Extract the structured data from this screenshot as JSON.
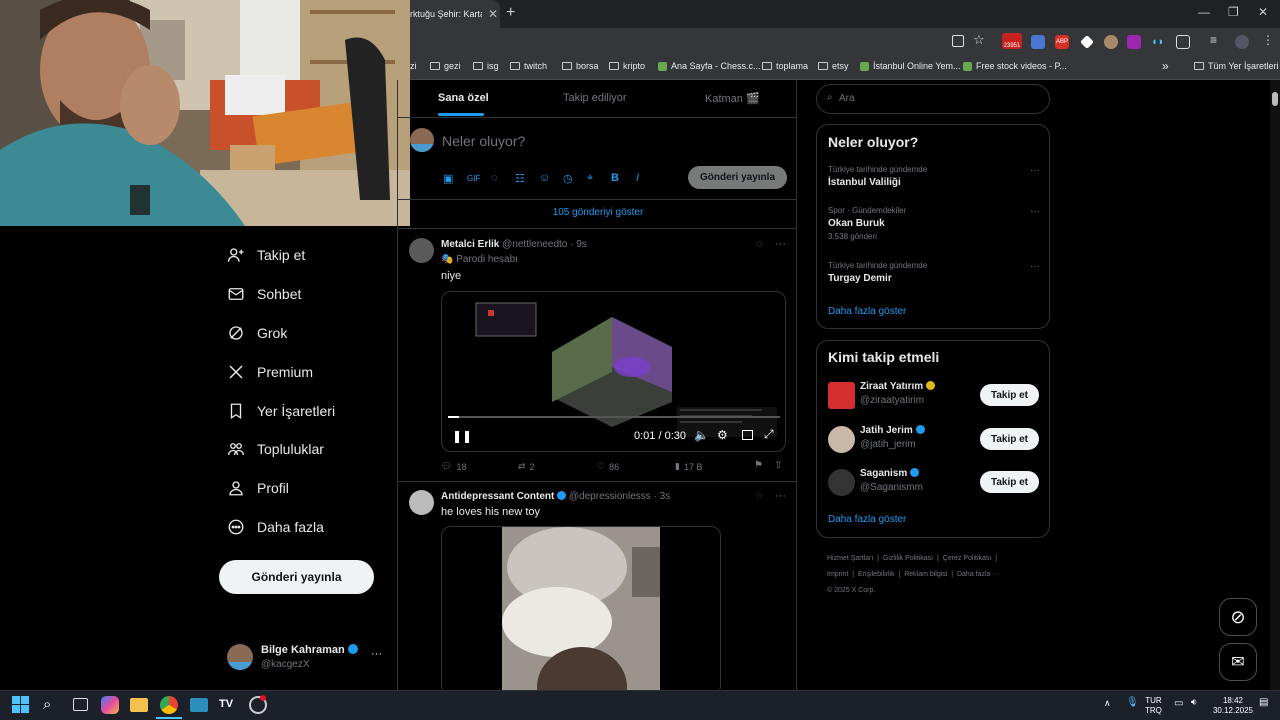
{
  "browser": {
    "tab_title": "rktuğu Şehir: Karta",
    "tab_close": "✕",
    "new_tab": "+",
    "extension_badge": "23951",
    "bookmarks": [
      {
        "label": "izi",
        "type": "text"
      },
      {
        "label": "gezi",
        "type": "folder"
      },
      {
        "label": "isg",
        "type": "folder"
      },
      {
        "label": "twitch",
        "type": "folder"
      },
      {
        "label": "borsa",
        "type": "folder"
      },
      {
        "label": "kripto",
        "type": "folder"
      },
      {
        "label": "Ana Sayfa - Chess.c...",
        "type": "site"
      },
      {
        "label": "toplama",
        "type": "folder"
      },
      {
        "label": "etsy",
        "type": "folder"
      },
      {
        "label": "İstanbul Online Yem...",
        "type": "site"
      },
      {
        "label": "Free stock videos - P...",
        "type": "site"
      },
      {
        "label": "Tüm Yer İşaretleri",
        "type": "folder"
      }
    ],
    "more_bookmarks": "»"
  },
  "nav": {
    "items": [
      {
        "label": "Takip et",
        "icon": "add-user-icon"
      },
      {
        "label": "Sohbet",
        "icon": "mail-icon"
      },
      {
        "label": "Grok",
        "icon": "grok-icon"
      },
      {
        "label": "Premium",
        "icon": "x-logo-icon"
      },
      {
        "label": "Yer İşaretleri",
        "icon": "bookmark-icon"
      },
      {
        "label": "Topluluklar",
        "icon": "communities-icon"
      },
      {
        "label": "Profil",
        "icon": "profile-icon"
      },
      {
        "label": "Daha fazla",
        "icon": "more-circle-icon"
      }
    ],
    "post_button": "Gönderi yayınla",
    "account": {
      "name": "Bilge Kahraman",
      "handle": "@kacgezX",
      "more": "···"
    }
  },
  "feed": {
    "tabs": [
      "Sana özel",
      "Takip ediliyor",
      "Katman 🎬"
    ],
    "compose_placeholder": "Neler oluyor?",
    "compose_button": "Gönderi yayınla",
    "show_more_posts": "105 gönderiyi göster",
    "posts": [
      {
        "name": "Metalci Erlik",
        "handle": "@nettleneedto · 9s",
        "badge": "Parodi hesabı",
        "text": "niye",
        "video_time": "0:01 / 0:30",
        "video_progress": 0.033,
        "replies": "18",
        "reposts": "2",
        "likes": "86",
        "views": "17 B"
      },
      {
        "name": "Antidepressant Content",
        "handle": "@depressionlesss · 3s",
        "text": "he loves his new toy"
      }
    ]
  },
  "sidebar": {
    "search_placeholder": "Ara",
    "trends_title": "Neler oluyor?",
    "trends": [
      {
        "context": "Türkiye tarihinde gündemde",
        "title": "İstanbul Valiliği",
        "count": ""
      },
      {
        "context": "Spor · Gündemdekiler",
        "title": "Okan Buruk",
        "count": "3.538 gönderi"
      },
      {
        "context": "Türkiye tarihinde gündemde",
        "title": "Turgay Demir",
        "count": ""
      }
    ],
    "trends_more": "Daha fazla göster",
    "who_title": "Kimi takip etmeli",
    "who": [
      {
        "name": "Ziraat Yatırım",
        "handle": "@ziraatyatirim",
        "button": "Takip et"
      },
      {
        "name": "Jatih Jerim",
        "handle": "@jatih_jerim",
        "button": "Takip et"
      },
      {
        "name": "Saganism",
        "handle": "@Saganismm",
        "button": "Takip et"
      }
    ],
    "who_more": "Daha fazla göster",
    "footer": [
      "Hizmet Şartları",
      "Gizlilik Politikası",
      "Çerez Politikası",
      "Imprint",
      "Erişilebilirlik",
      "Reklam bilgisi",
      "Daha fazla ···",
      "© 2025 X Corp."
    ]
  },
  "taskbar": {
    "lang_top": "TUR",
    "lang_bottom": "TRQ",
    "time": "18:42",
    "date": "30.12.2025"
  },
  "colors": {
    "accent": "#1d9bf0",
    "bg": "#000000",
    "border": "#2f3336",
    "muted": "#71767b"
  }
}
